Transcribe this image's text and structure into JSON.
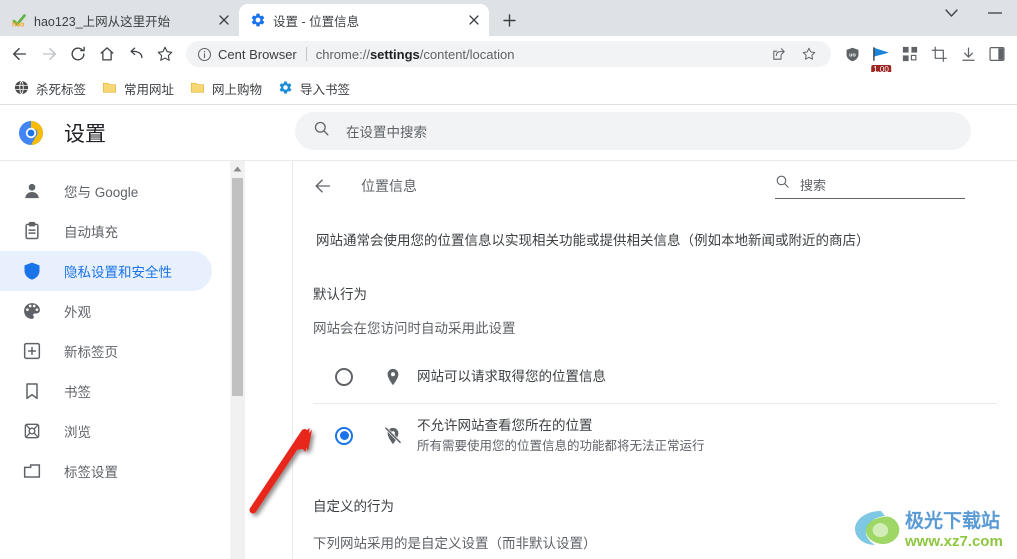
{
  "window": {
    "controls": [
      {
        "name": "chevron-down",
        "label": "∨"
      },
      {
        "name": "minimize",
        "label": "—"
      }
    ]
  },
  "tabs": [
    {
      "title": "hao123_上网从这里开始",
      "favicon": "hao123-icon",
      "active": false,
      "close_label": "✕"
    },
    {
      "title": "设置 - 位置信息",
      "favicon": "gear-icon",
      "active": true,
      "close_label": "✕"
    }
  ],
  "new_tab_label": "+",
  "toolbar": {
    "back_label": "←",
    "forward_label": "→",
    "reload_label": "↻",
    "home_label": "⌂",
    "undo_label": "↩",
    "bookmark_star_label": "☆",
    "omnibox": {
      "info_icon": "info-circle-icon",
      "brand": "Cent Browser",
      "url_prefix": "chrome://",
      "url_bold": "settings",
      "url_suffix": "/content/location",
      "share_icon": "share-icon",
      "star_icon": "star-icon"
    },
    "extensions": [
      {
        "name": "ublock-origin-icon",
        "badge": null
      },
      {
        "name": "flag-extension-icon",
        "badge": "1.00"
      },
      {
        "name": "apps-grid-icon",
        "badge": null
      },
      {
        "name": "crop-tool-icon",
        "badge": null
      },
      {
        "name": "download-icon",
        "badge": null
      },
      {
        "name": "side-panel-icon",
        "badge": null
      }
    ]
  },
  "bookmarks": [
    {
      "label": "杀死标签",
      "icon": "globe-dark-icon"
    },
    {
      "label": "常用网址",
      "icon": "folder-icon"
    },
    {
      "label": "网上购物",
      "icon": "folder-icon"
    },
    {
      "label": "导入书签",
      "icon": "gear-blue-icon"
    }
  ],
  "settings": {
    "brand_title": "设置",
    "logo": "chrome-settings-logo",
    "search": {
      "placeholder": "在设置中搜索",
      "icon": "search-icon",
      "value": ""
    }
  },
  "sidebar": {
    "items": [
      {
        "label": "您与 Google",
        "icon": "person-icon",
        "selected": false
      },
      {
        "label": "自动填充",
        "icon": "clipboard-icon",
        "selected": false
      },
      {
        "label": "隐私设置和安全性",
        "icon": "shield-icon",
        "selected": true
      },
      {
        "label": "外观",
        "icon": "palette-icon",
        "selected": false
      },
      {
        "label": "新标签页",
        "icon": "new-tab-page-icon",
        "selected": false
      },
      {
        "label": "书签",
        "icon": "bookmark-icon",
        "selected": false
      },
      {
        "label": "浏览",
        "icon": "browse-icon",
        "selected": false
      },
      {
        "label": "标签设置",
        "icon": "tab-settings-icon",
        "selected": false
      }
    ]
  },
  "main": {
    "back_icon": "arrow-left-icon",
    "title": "位置信息",
    "search": {
      "icon": "search-icon",
      "placeholder": "搜索",
      "value": ""
    },
    "intro": "网站通常会使用您的位置信息以实现相关功能或提供相关信息（例如本地新闻或附近的商店）",
    "default_behavior": {
      "heading": "默认行为",
      "subtext": "网站会在您访问时自动采用此设置",
      "options": [
        {
          "icon": "location-pin-icon",
          "label": "网站可以请求取得您的位置信息",
          "sublabel": "",
          "selected": false
        },
        {
          "icon": "location-pin-off-icon",
          "label": "不允许网站查看您所在的位置",
          "sublabel": "所有需要使用您的位置信息的功能都将无法正常运行",
          "selected": true
        }
      ]
    },
    "custom_behavior": {
      "heading": "自定义的行为",
      "subtext": "下列网站采用的是自定义设置（而非默认设置）"
    }
  },
  "annotation": {
    "arrow": "red-arrow-pointing-to-selected-radio",
    "color": "#e8261c"
  },
  "watermark": {
    "text": "极光下载站",
    "url": "www.xz7.com"
  },
  "colors": {
    "accent_blue": "#1a73e8",
    "selected_pill": "#e8f0fe",
    "tabstrip_bg": "#dee1e6",
    "omnibox_bg": "#f1f3f4",
    "badge_red": "#9b2523"
  }
}
